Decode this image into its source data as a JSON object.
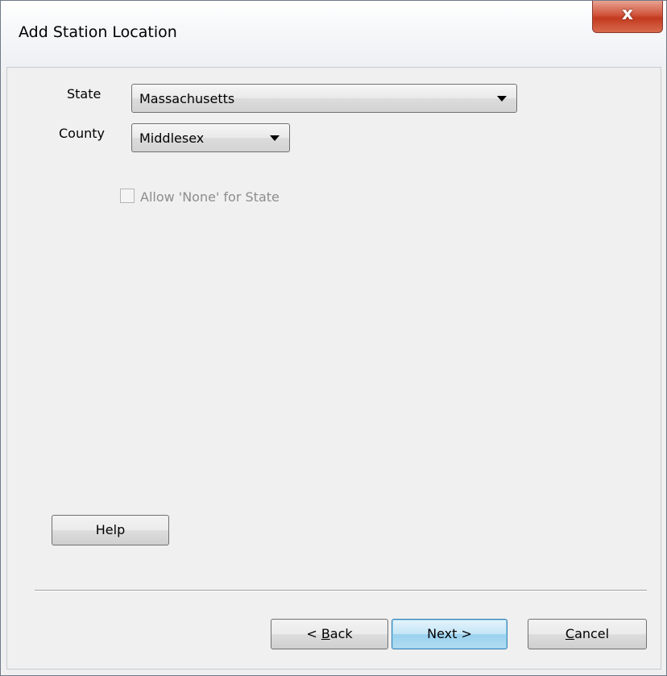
{
  "window": {
    "title": "Add Station Location",
    "close_glyph": "x"
  },
  "form": {
    "state_label": "State",
    "state_value": "Massachusetts",
    "county_label": "County",
    "county_value": "Middlesex",
    "allow_none_label": "Allow 'None' for State",
    "allow_none_checked": false,
    "allow_none_enabled": false
  },
  "buttons": {
    "help": "Help",
    "back_prefix": "< ",
    "back_mnemonic": "B",
    "back_rest": "ack",
    "next": "Next >",
    "cancel_mnemonic": "C",
    "cancel_rest": "ancel"
  },
  "icons": {
    "close": "close-icon",
    "dropdown": "chevron-down-icon"
  }
}
